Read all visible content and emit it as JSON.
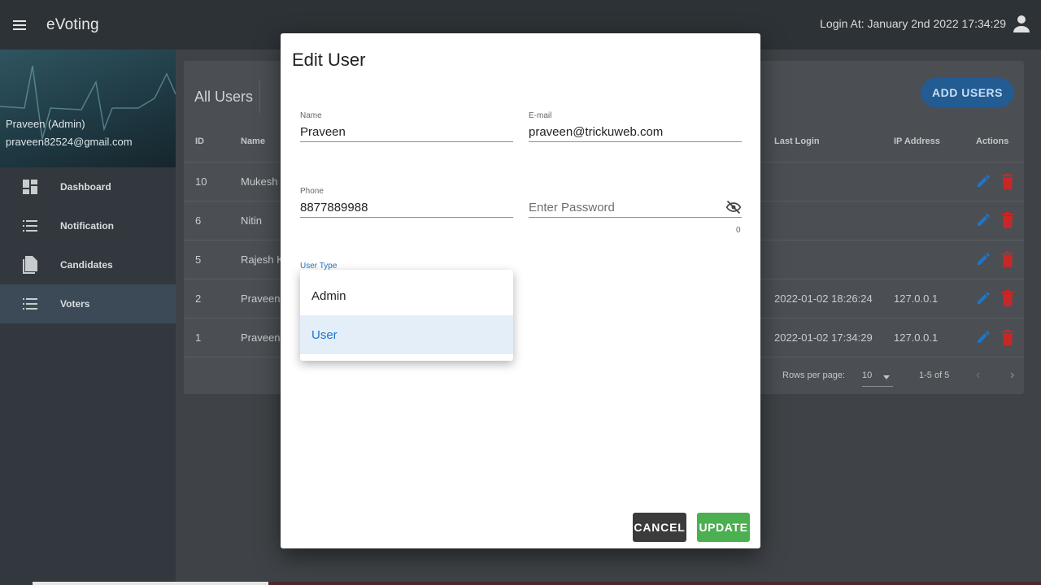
{
  "appbar": {
    "title": "eVoting",
    "login_info": "Login At: January 2nd 2022 17:34:29"
  },
  "sidebar": {
    "profile_name": "Praveen (Admin)",
    "profile_email": "praveen82524@gmail.com",
    "items": [
      {
        "label": "Dashboard",
        "icon": "dashboard-icon"
      },
      {
        "label": "Notification",
        "icon": "list-icon"
      },
      {
        "label": "Candidates",
        "icon": "document-icon"
      },
      {
        "label": "Voters",
        "icon": "list-icon",
        "active": true
      }
    ]
  },
  "main": {
    "title": "All Users",
    "add_button": "ADD USERS",
    "headers": {
      "id": "ID",
      "name": "Name",
      "last_login": "Last Login",
      "ip": "IP Address",
      "actions": "Actions"
    },
    "rows": [
      {
        "id": "10",
        "name": "Mukesh",
        "last_login": "",
        "ip": ""
      },
      {
        "id": "6",
        "name": "Nitin",
        "last_login": "",
        "ip": ""
      },
      {
        "id": "5",
        "name": "Rajesh Ku",
        "last_login": "",
        "ip": ""
      },
      {
        "id": "2",
        "name": "Praveen",
        "last_login": "2022-01-02 18:26:24",
        "ip": "127.0.0.1"
      },
      {
        "id": "1",
        "name": "Praveen",
        "last_login": "2022-01-02 17:34:29",
        "ip": "127.0.0.1"
      }
    ],
    "rows_per_page_label": "Rows per page:",
    "rows_per_page_value": "10",
    "range": "1-5 of 5"
  },
  "dialog": {
    "title": "Edit User",
    "name_label": "Name",
    "name_value": "Praveen",
    "email_label": "E-mail",
    "email_value": "praveen@trickuweb.com",
    "phone_label": "Phone",
    "phone_value": "8877889988",
    "password_placeholder": "Enter Password",
    "password_counter": "0",
    "user_type_label": "User Type",
    "user_type_options": [
      "Admin",
      "User"
    ],
    "user_type_selected": "User",
    "cancel_label": "CANCEL",
    "update_label": "UPDATE"
  },
  "colors": {
    "accent": "#1e74c9",
    "update_button": "#4caf50",
    "delete_icon": "#c62828",
    "edit_icon": "#1e74c9"
  }
}
